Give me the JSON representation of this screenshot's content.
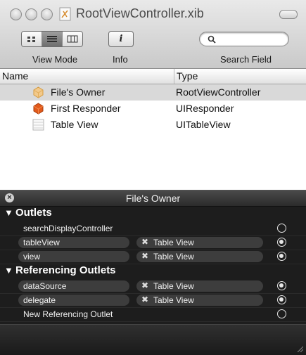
{
  "window": {
    "title": "RootViewController.xib"
  },
  "toolbar": {
    "view_mode_label": "View Mode",
    "info_label": "Info",
    "info_glyph": "i",
    "search_label": "Search Field",
    "search_placeholder": ""
  },
  "table": {
    "columns": [
      "Name",
      "Type"
    ],
    "rows": [
      {
        "name": "File's Owner",
        "type": "RootViewController",
        "icon": "files-owner-icon",
        "selected": true
      },
      {
        "name": "First Responder",
        "type": "UIResponder",
        "icon": "first-responder-icon",
        "selected": false
      },
      {
        "name": "Table View",
        "type": "UITableView",
        "icon": "table-view-icon",
        "selected": false
      }
    ]
  },
  "hud": {
    "title": "File's Owner",
    "close_glyph": "×",
    "outlets_label": "Outlets",
    "outlets": [
      {
        "name": "searchDisplayController",
        "target": "",
        "connected": false
      },
      {
        "name": "tableView",
        "target": "Table View",
        "connected": true
      },
      {
        "name": "view",
        "target": "Table View",
        "connected": true
      }
    ],
    "referencing_label": "Referencing Outlets",
    "referencing": [
      {
        "name": "dataSource",
        "target": "Table View",
        "connected": true
      },
      {
        "name": "delegate",
        "target": "Table View",
        "connected": true
      },
      {
        "name": "New Referencing Outlet",
        "target": "",
        "connected": false
      }
    ],
    "disconnect_glyph": "✖",
    "triangle_glyph": "▼"
  },
  "colors": {
    "hud_bg": "#141414",
    "selection": "#d9d9d9"
  }
}
